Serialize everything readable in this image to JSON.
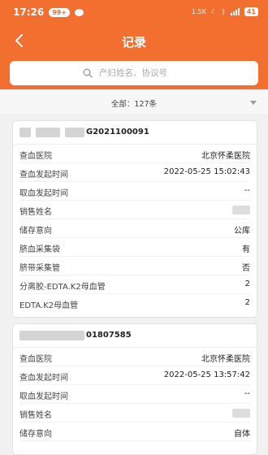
{
  "status_bar": {
    "time": "17:26",
    "notif_count": "99+",
    "speed": "1.5K",
    "battery": "41"
  },
  "header": {
    "title": "记录"
  },
  "search": {
    "placeholder": "产妇姓名、协议号"
  },
  "summary": {
    "text": "全部：127条"
  },
  "records": [
    {
      "order_suffix": "G2021100091",
      "fields": [
        {
          "label": "查血医院",
          "value": "北京怀柔医院"
        },
        {
          "label": "查血发起时间",
          "value": "2022-05-25 15:02:43"
        },
        {
          "label": "取血发起时间",
          "value": "--"
        },
        {
          "label": "销售姓名",
          "value": ""
        },
        {
          "label": "储存意向",
          "value": "公库"
        },
        {
          "label": "脐血采集袋",
          "value": "有"
        },
        {
          "label": "脐带采集管",
          "value": "否"
        },
        {
          "label": "分离胶-EDTA.K2母血管",
          "value": "2"
        },
        {
          "label": "EDTA.K2母血管",
          "value": "2"
        }
      ]
    },
    {
      "order_suffix": "01807585",
      "fields": [
        {
          "label": "查血医院",
          "value": "北京怀柔医院"
        },
        {
          "label": "查血发起时间",
          "value": "2022-05-25 13:57:42"
        },
        {
          "label": "取血发起时间",
          "value": "--"
        },
        {
          "label": "销售姓名",
          "value": ""
        },
        {
          "label": "储存意向",
          "value": "自体"
        }
      ]
    }
  ]
}
